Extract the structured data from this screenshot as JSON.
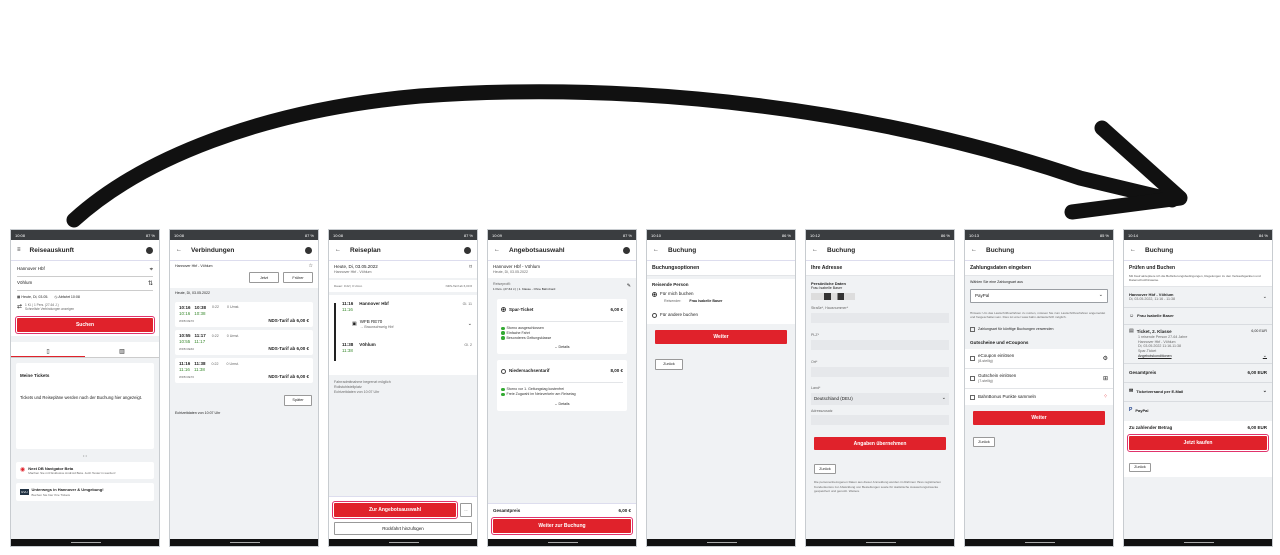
{
  "statusbar": {
    "t1": "10:08",
    "t2": "10:08",
    "t3": "10:08",
    "t4": "10:09",
    "t5": "10:10",
    "t6": "10:12",
    "t7": "10:13",
    "t8": "10:14",
    "battery1": "87 %",
    "battery2": "86 %",
    "battery3": "85 %",
    "battery4": "84 %"
  },
  "s1": {
    "title": "Reiseauskunft",
    "from": "Hannover Hbf",
    "to": "Vöhlum",
    "date": "Heute, Di, 03.05.",
    "depart": "Abfahrt 10:08",
    "options": "1 Kl. | 1 Pers. (27-64 J.)",
    "options2": "Schnellste Verbindungen anzeigen",
    "search": "Suchen",
    "tickets_title": "Meine Tickets",
    "tickets_text": "Tickets und Reisepläne werden nach der Buchung hier angezeigt.",
    "promo1_title": "Next DB Navigator Beta",
    "promo1_text": "Machen Sie mit! Exklusive Android Beta. Jetzt Tester:in werden!",
    "promo2_title": "Unterwegs in Hannover & Umgebung!",
    "promo2_text": "Buchen Sie hier Ihre Tickets"
  },
  "s2": {
    "title": "Verbindungen",
    "route": "Hannover Hbf - Vöhlum",
    "now": "Jetzt",
    "earlier": "Früher",
    "date": "Heute, Di, 03.05.2022",
    "conns": [
      {
        "dep": "10:16",
        "arr": "10:38",
        "dep2": "10:16",
        "arr2": "10:38",
        "dur": "0:22",
        "chg": "0 Umst.",
        "train": "WFB RE70",
        "price": "NDS-Tarif ab 6,00 €"
      },
      {
        "dep": "10:55",
        "arr": "11:17",
        "dep2": "10:55",
        "arr2": "11:17",
        "dur": "0:22",
        "chg": "0 Umst.",
        "train": "WFB RE60",
        "price": "NDS-Tarif ab 6,00 €"
      },
      {
        "dep": "11:16",
        "arr": "11:38",
        "dep2": "11:16",
        "arr2": "11:38",
        "dur": "0:22",
        "chg": "0 Umst.",
        "train": "WFB RE70",
        "price": "NDS-Tarif ab 6,00 €"
      }
    ],
    "later": "Später",
    "realtime": "Echtzeitdaten von 10:07 Uhr"
  },
  "s3": {
    "title": "Reiseplan",
    "date": "Heute, Di, 03.05.2022",
    "route": "Hannover Hbf - Vöhlum",
    "meta": "Dauer: 0:22 | 0 Umst.",
    "meta2": "NDS-Tarif ab 6,00 €",
    "dep": "11:16",
    "dep2": "11:16",
    "from": "Hannover Hbf",
    "track1": "Gl. 11",
    "train": "WFB RE70",
    "dir": "→ Braunschweig Hbf",
    "arr": "11:38",
    "arr2": "11:38",
    "to": "Vöhlum",
    "track2": "Gl. 2",
    "info1": "Fahrradmitnahme begrenzt möglich",
    "info2": "Rollstuhlstellplatz",
    "info3": "Echtzeitdaten von 10:07 Uhr",
    "offer_btn": "Zur Angebotsauswahl",
    "more": "...",
    "return_btn": "Rückfahrt hinzufügen"
  },
  "s4": {
    "title": "Angebotsauswahl",
    "route": "Hannover Hbf - Vöhlum",
    "date": "Heute, Di, 03.05.2022",
    "profile": "Reiseprofil:",
    "profile2": "1 Pers. (27-64 J.) | 1. Klasse - Ohne BahnCard",
    "offers": [
      {
        "name": "Spar-Ticket",
        "price": "6,00 €",
        "f1": "Storno ausgeschlossen",
        "f2": "Einfache Fahrt",
        "f3": "Besonderes Geltungsklasse",
        "details": "Details"
      },
      {
        "name": "Niedersachsentarif",
        "price": "8,00 €",
        "f1": "Storno vor 1. Geltungstag kostenfrei",
        "f2": "Freie Zugwahl im Netzverkehr am Reisetag",
        "details": "Details"
      }
    ],
    "total_label": "Gesamtpreis",
    "total": "6,00 €",
    "next": "Weiter zur Buchung"
  },
  "s5": {
    "title": "Buchung",
    "options": "Buchungsoptionen",
    "person_title": "Reisende Person",
    "opt1": "Für mich buchen",
    "traveler_label": "Reisender:",
    "traveler": "Frau Isabelle Baser",
    "opt2": "Für andere buchen",
    "next": "Weiter",
    "back": "Zurück"
  },
  "s6": {
    "title": "Buchung",
    "section": "Ihre Adresse",
    "personal": "Persönliche Daten",
    "name": "Frau Isabelle Baser",
    "street": "Straße*, Hausnummer*",
    "zip": "PLZ*",
    "city": "Ort*",
    "country_label": "Land*",
    "country": "Deutschland (DEU)",
    "extra": "Adresszusatz",
    "apply": "Angaben übernehmen",
    "back": "Zurück",
    "note": "Die personenbezogenen Daten aus dieser Anmeldung werden im Rahmen Ihres registrierten Kundenkontos zur Abwicklung von Bestellungen sowie für statistische Auswertungszwecke gespeichert und genutzt. Weitere"
  },
  "s7": {
    "title": "Buchung",
    "section": "Zahlungsdaten eingeben",
    "choose": "Wählen Sie eine Zahlungsart aus",
    "payment": "PayPal",
    "hint": "Hinweis: Um das Lastschriftverfahren zu nutzen, müssen Sie zum Lastschriftverfahren angemeldet und freigeschaltet sein. Dies ist unter www.bahn.de/lastschrift möglich.",
    "save_pay": "Zahlungsart für künftige Buchungen verwenden",
    "vouchers": "Gutscheine und eCoupons",
    "v1": "eCoupon einlösen",
    "v1s": "(8-stellig)",
    "v2": "Gutschein einlösen",
    "v2s": "(7-stellig)",
    "v3": "BahnBonus Punkte sammeln",
    "next": "Weiter",
    "back": "Zurück"
  },
  "s8": {
    "title": "Buchung",
    "section": "Prüfen und Buchen",
    "terms": "Mit Kauf akzeptiere ich die Beförderungsbedingungen, Regelungen zu den Verkaufsgeräten und Datenschutzhinweise.",
    "route": "Hannover Hbf - Vöhlum",
    "route_date": "Di, 03.05.2022, 11:16 - 11:38",
    "traveler": "Frau Isabelle Baser",
    "ticket": "Ticket, 2. Klasse",
    "ticket_price": "6,00 EUR",
    "t1": "1 reisende Person 27-64 Jahre",
    "t2": "Hannover Hbf - Vöhlum",
    "t3": "Di, 03.05.2022 11:16-11:38",
    "t4": "Spar-Ticket",
    "conditions": "Angebotskonditionen",
    "total_label": "Gesamtpreis",
    "total": "6,00 EUR",
    "email": "Ticketversand per E-Mail",
    "paypal": "PayPal",
    "pay_label": "Zu zahlender Betrag",
    "pay": "6,00 EUR",
    "buy": "Jetzt kaufen",
    "back": "Zurück"
  },
  "colors": {
    "db_red": "#e0222b",
    "highlight": "#e0336c",
    "arrow": "#111111"
  }
}
